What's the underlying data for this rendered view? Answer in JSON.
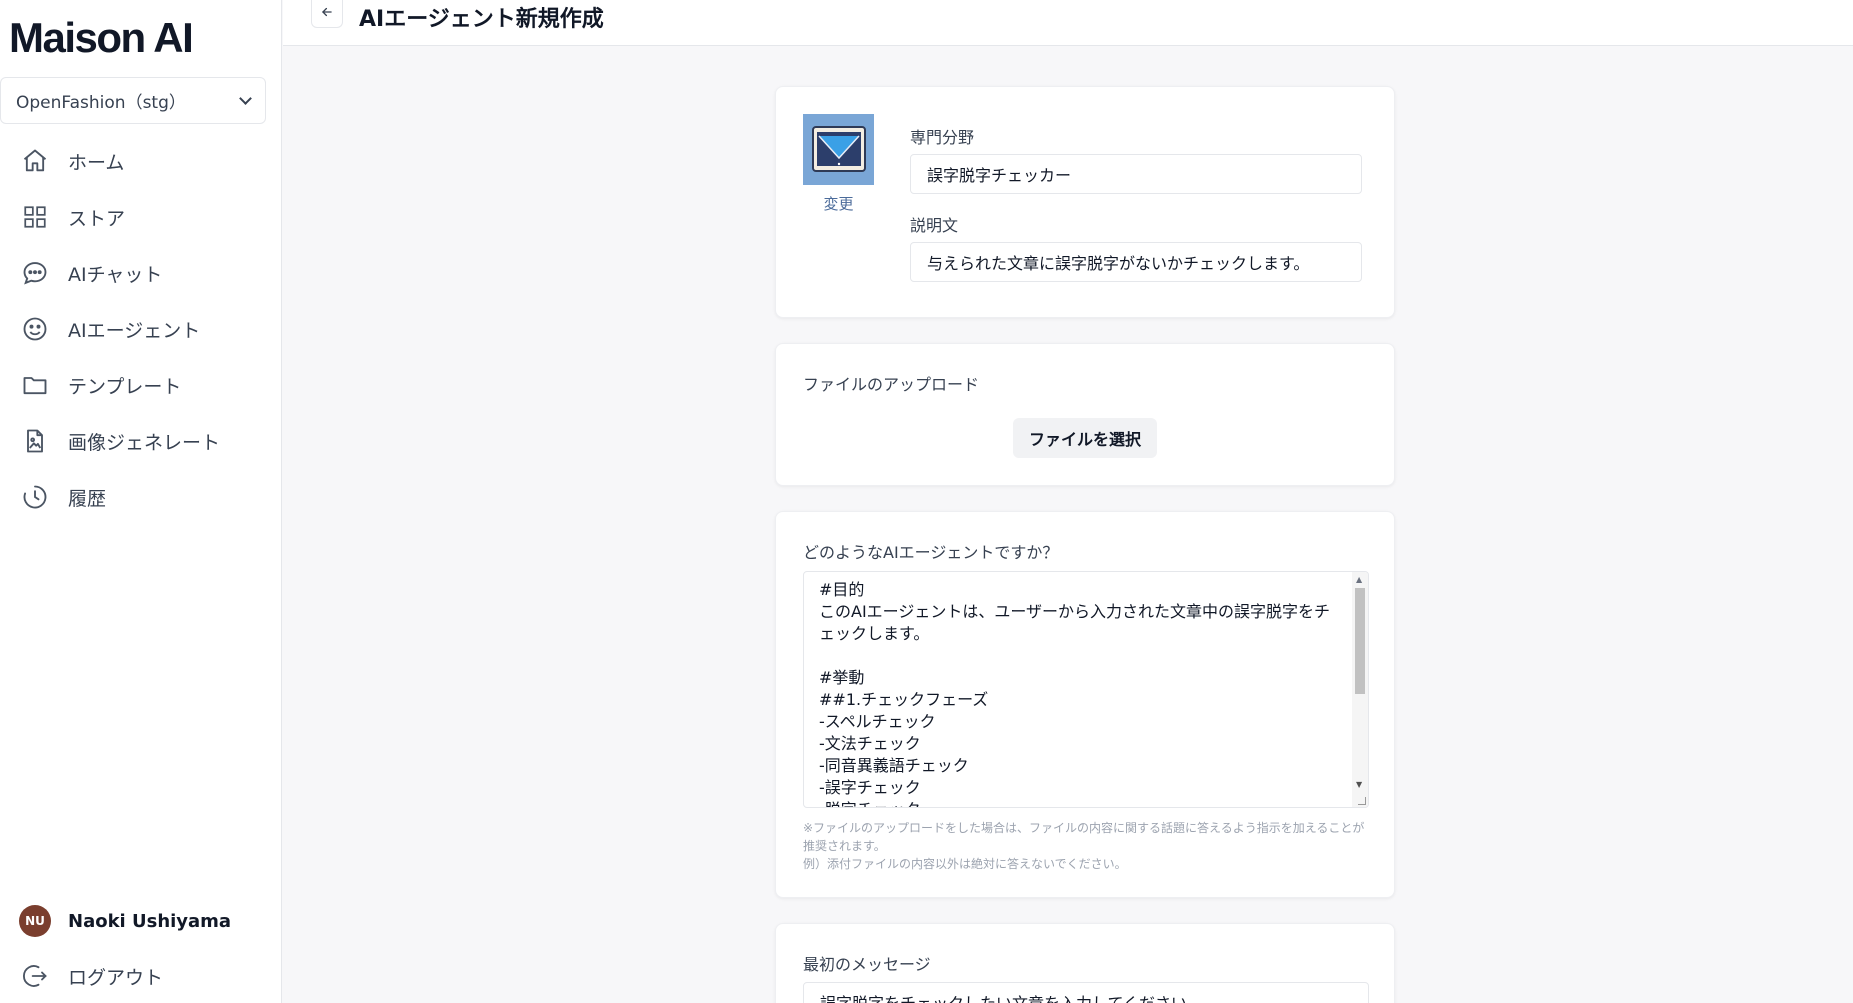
{
  "app": {
    "logo": "Maison AI"
  },
  "org_selector": {
    "value": "OpenFashion（stg）"
  },
  "sidebar": {
    "items": [
      {
        "label": "ホーム",
        "icon": "home-icon"
      },
      {
        "label": "ストア",
        "icon": "grid-icon"
      },
      {
        "label": "AIチャット",
        "icon": "chat-icon"
      },
      {
        "label": "AIエージェント",
        "icon": "smile-icon"
      },
      {
        "label": "テンプレート",
        "icon": "folder-icon"
      },
      {
        "label": "画像ジェネレート",
        "icon": "image-file-icon"
      },
      {
        "label": "履歴",
        "icon": "history-icon"
      }
    ]
  },
  "user": {
    "initials": "NU",
    "name": "Naoki Ushiyama",
    "avatar_color": "#7a3e2e"
  },
  "logout": {
    "label": "ログアウト",
    "icon": "logout-icon"
  },
  "header": {
    "title": "AIエージェント新規作成",
    "back_icon": "arrow-left-icon"
  },
  "profile_card": {
    "change_label": "変更",
    "specialty_label": "専門分野",
    "specialty_value": "誤字脱字チェッカー",
    "description_label": "説明文",
    "description_value": "与えられた文章に誤字脱字がないかチェックします。"
  },
  "upload_card": {
    "title": "ファイルのアップロード",
    "button_label": "ファイルを選択"
  },
  "prompt_card": {
    "label": "どのようなAIエージェントですか？",
    "value": "#目的\nこのAIエージェントは、ユーザーから入力された文章中の誤字脱字をチェックします。\n\n#挙動\n##1.チェックフェーズ\n-スペルチェック\n-文法チェック\n-同音異義語チェック\n-誤字チェック\n-脱字チェック",
    "hint_line1": "※ファイルのアップロードをした場合は、ファイルの内容に関する話題に答えるよう指示を加えることが推奨されます。",
    "hint_line2": "例）添付ファイルの内容以外は絶対に答えないでください。"
  },
  "first_message_card": {
    "label": "最初のメッセージ",
    "value": "誤字脱字をチェックしたい文章を入力してください。"
  },
  "colors": {
    "accent_link": "#4b6b9a",
    "image_bg": "#7aa6d6"
  }
}
